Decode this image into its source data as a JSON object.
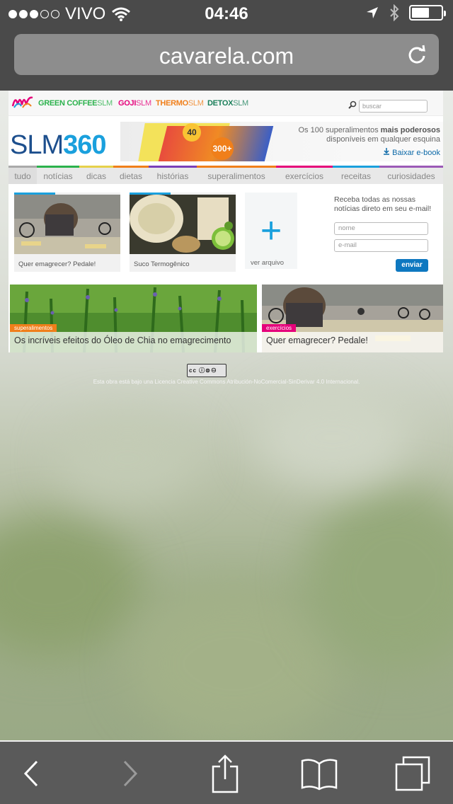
{
  "status_bar": {
    "carrier": "VIVO",
    "time": "04:46",
    "battery_level": 0.55
  },
  "browser": {
    "url": "cavarela.com"
  },
  "site": {
    "brands": [
      {
        "name": "GREEN COFFEE",
        "suffix": "SLM",
        "color": "#2bb24c"
      },
      {
        "name": "GOJI",
        "suffix": "SLM",
        "color": "#e5007a"
      },
      {
        "name": "THERMO",
        "suffix": "SLM",
        "color": "#f07f1a"
      },
      {
        "name": "DETOX",
        "suffix": "SLM",
        "color": "#1a7f5a"
      }
    ],
    "search_placeholder": "buscar",
    "logo": {
      "slm": "SLM",
      "number": "360"
    },
    "banner": {
      "line1_pre": "Os 100 superalimentos ",
      "line1_bold": "mais poderosos",
      "line2": "disponíveis em qualquer esquina",
      "ebook": "Baixar e-book",
      "badge_top": "40",
      "badge_bottom": "300+"
    },
    "nav": [
      {
        "label": "tudo",
        "color": "#aaaaaa"
      },
      {
        "label": "notícias",
        "color": "#2bb24c"
      },
      {
        "label": "dicas",
        "color": "#e6d14b"
      },
      {
        "label": "dietas",
        "color": "#f07f1a"
      },
      {
        "label": "histórias",
        "color": "#7a3fb8"
      },
      {
        "label": "superalimentos",
        "color": "#f07f1a"
      },
      {
        "label": "exercícios",
        "color": "#e5007a"
      },
      {
        "label": "receitas",
        "color": "#1aa0dd"
      },
      {
        "label": "curiosidades",
        "color": "#9b59b6"
      }
    ],
    "cards": [
      {
        "caption": "Quer emagrecer? Pedale!"
      },
      {
        "caption": "Suco Termogênico"
      }
    ],
    "archive_label": "ver arquivo",
    "newsletter": {
      "text": "Receba todas as nossas notícias direto em seu e-mail!",
      "name_placeholder": "nome",
      "email_placeholder": "e-mail",
      "submit": "enviar"
    },
    "features": [
      {
        "tag": "superalimentos",
        "title": "Os incríveis efeitos do Óleo de Chia no emagrecimento",
        "tag_color": "#f07f1a"
      },
      {
        "tag": "exercícios",
        "title": "Quer emagrecer? Pedale!",
        "tag_color": "#e5007a"
      }
    ],
    "cc_badge": "cc",
    "license": "Esta obra está bajo una Licencia Creative Commons Atribución-NoComercial-SinDerivar 4.0 Internacional."
  }
}
